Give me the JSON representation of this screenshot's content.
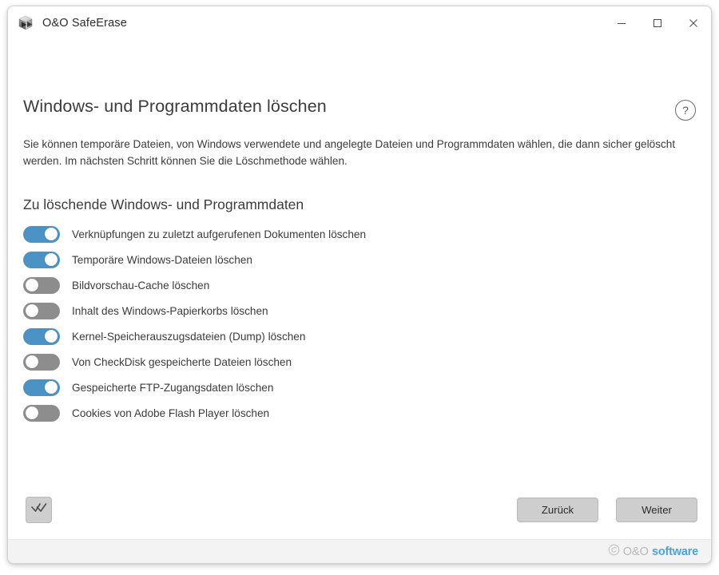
{
  "window": {
    "title": "O&O SafeErase",
    "icon": "cube-arrow-icon",
    "controls": {
      "minimize": "minimize-icon",
      "maximize": "maximize-icon",
      "close": "close-icon"
    }
  },
  "content": {
    "help_icon": "?",
    "page_title": "Windows- und Programmdaten löschen",
    "description": "Sie können temporäre Dateien, von Windows verwendete und angelegte Dateien und Programmdaten wählen, die dann sicher gelöscht werden. Im nächsten Schritt können Sie die Löschmethode wählen.",
    "section_title": "Zu löschende Windows- und Programmdaten",
    "toggles": [
      {
        "label": "Verknüpfungen zu zuletzt aufgerufenen Dokumenten löschen",
        "on": true
      },
      {
        "label": "Temporäre Windows-Dateien löschen",
        "on": true
      },
      {
        "label": "Bildvorschau-Cache löschen",
        "on": false
      },
      {
        "label": "Inhalt des Windows-Papierkorbs löschen",
        "on": false
      },
      {
        "label": "Kernel-Speicherauszugsdateien (Dump) löschen",
        "on": true
      },
      {
        "label": "Von CheckDisk gespeicherte Dateien löschen",
        "on": false
      },
      {
        "label": "Gespeicherte FTP-Zugangsdaten löschen",
        "on": true
      },
      {
        "label": "Cookies von Adobe Flash Player löschen",
        "on": false
      }
    ]
  },
  "actions": {
    "select_all_icon": "double-check-icon",
    "back_label": "Zurück",
    "next_label": "Weiter"
  },
  "footer": {
    "brand_mark": "@",
    "brand_name": "O&O",
    "brand_suffix": "software"
  },
  "colors": {
    "toggle_on": "#4a93c4",
    "toggle_off": "#8d8d8d",
    "brand_blue": "#4aa3d8",
    "button_face": "#cecece"
  }
}
